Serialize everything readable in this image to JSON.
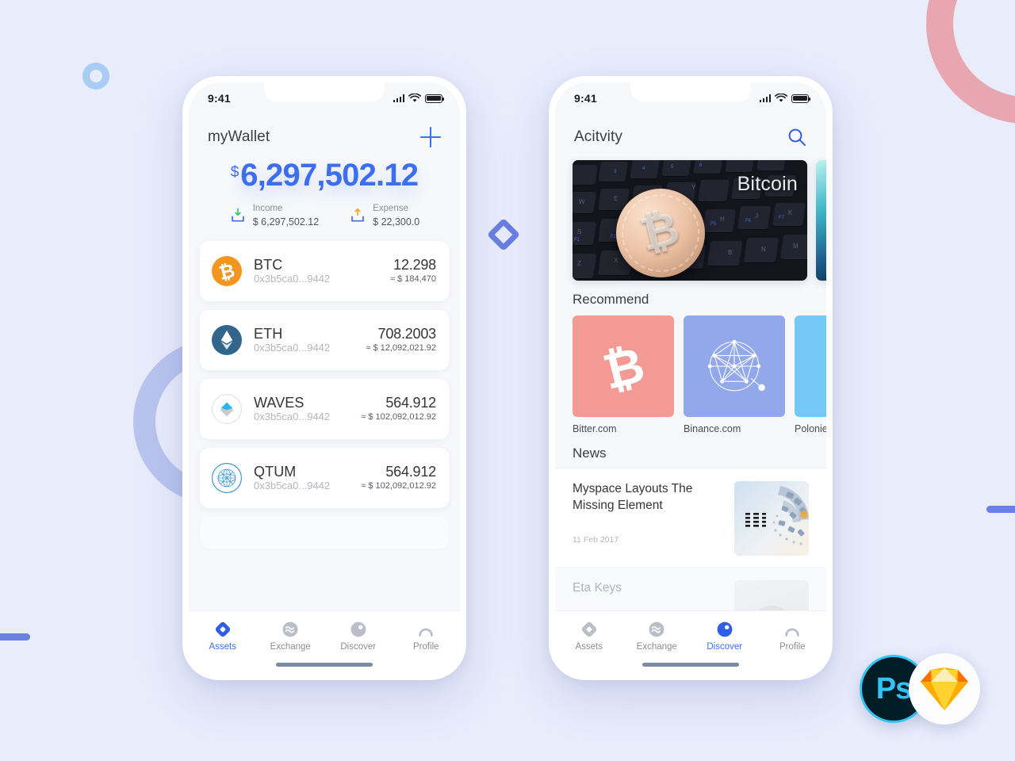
{
  "decor": {
    "pink_ring": "#e8a6b0",
    "blue_ring": "#a8cdf4",
    "peri_ring": "#b9c4ee",
    "diamond": "#6b7fe0",
    "bar": "#6b7fe0",
    "background": "#e8ecfb"
  },
  "wallet_screen": {
    "status": {
      "time": "9:41",
      "signal_icon": "cellular-signal-icon",
      "wifi_icon": "wifi-icon",
      "battery_icon": "battery-icon"
    },
    "header": {
      "title": "myWallet",
      "add_icon": "plus-icon"
    },
    "balance": {
      "currency": "$",
      "amount": "6,297,502.12",
      "accent": "#3d6ef0"
    },
    "income": {
      "label": "Income",
      "value": "$ 6,297,502.12",
      "icon": "income-download-icon",
      "arrow_color": "#3cc46a"
    },
    "expense": {
      "label": "Expense",
      "value": "$ 22,300.0",
      "icon": "expense-upload-icon",
      "arrow_color": "#f5a623"
    },
    "coins": [
      {
        "symbol": "BTC",
        "address": "0x3b5ca0...9442",
        "amount": "12.298",
        "usd": "≈ $ 184,470",
        "icon": "btc-coin-icon",
        "color": "#f2961f"
      },
      {
        "symbol": "ETH",
        "address": "0x3b5ca0...9442",
        "amount": "708.2003",
        "usd": "≈ $ 12,092,021.92",
        "icon": "eth-coin-icon",
        "color": "#33658c"
      },
      {
        "symbol": "WAVES",
        "address": "0x3b5ca0...9442",
        "amount": "564.912",
        "usd": "≈ $ 102,092,012.92",
        "icon": "waves-coin-icon",
        "color": "#29b6e8"
      },
      {
        "symbol": "QTUM",
        "address": "0x3b5ca0...9442",
        "amount": "564.912",
        "usd": "≈ $ 102,092,012.92",
        "icon": "qtum-coin-icon",
        "color": "#2b8fd4"
      }
    ],
    "tabs": [
      {
        "label": "Assets",
        "icon": "assets-diamond-icon",
        "active": true
      },
      {
        "label": "Exchange",
        "icon": "exchange-wave-icon",
        "active": false
      },
      {
        "label": "Discover",
        "icon": "discover-compass-icon",
        "active": false
      },
      {
        "label": "Profile",
        "icon": "profile-person-icon",
        "active": false
      }
    ]
  },
  "activity_screen": {
    "status": {
      "time": "9:41",
      "signal_icon": "cellular-signal-icon",
      "wifi_icon": "wifi-icon",
      "battery_icon": "battery-icon"
    },
    "header": {
      "title": "Acitvity",
      "search_icon": "search-icon"
    },
    "hero": {
      "caption": "Bitcoin",
      "image": "bitcoin-coin-on-keyboard-photo"
    },
    "recommend": {
      "section_title": "Recommend",
      "items": [
        {
          "label": "Bitter.com",
          "color": "#f49a95",
          "icon": "bitcoin-b-icon"
        },
        {
          "label": "Binance.com",
          "color": "#93a8ea",
          "icon": "binance-network-icon"
        },
        {
          "label": "Polonie",
          "color": "#74c8f5",
          "icon": "poloniex-icon"
        }
      ]
    },
    "news": {
      "section_title": "News",
      "items": [
        {
          "title": "Myspace Layouts The Missing Element",
          "date": "11 Feb 2017",
          "thumb": "ibm-server-photo",
          "faded": false
        },
        {
          "title": "Eta Keys",
          "date": "",
          "thumb": "person-portrait-photo",
          "faded": true
        }
      ]
    },
    "tabs": [
      {
        "label": "Assets",
        "icon": "assets-diamond-icon",
        "active": false
      },
      {
        "label": "Exchange",
        "icon": "exchange-wave-icon",
        "active": false
      },
      {
        "label": "Discover",
        "icon": "discover-compass-icon",
        "active": true
      },
      {
        "label": "Profile",
        "icon": "profile-person-icon",
        "active": false
      }
    ]
  },
  "badges": {
    "photoshop": {
      "label": "Ps",
      "accent": "#31c5f4"
    },
    "sketch": {
      "label": "sketch-diamond-icon",
      "accent": "#fdad00"
    }
  }
}
